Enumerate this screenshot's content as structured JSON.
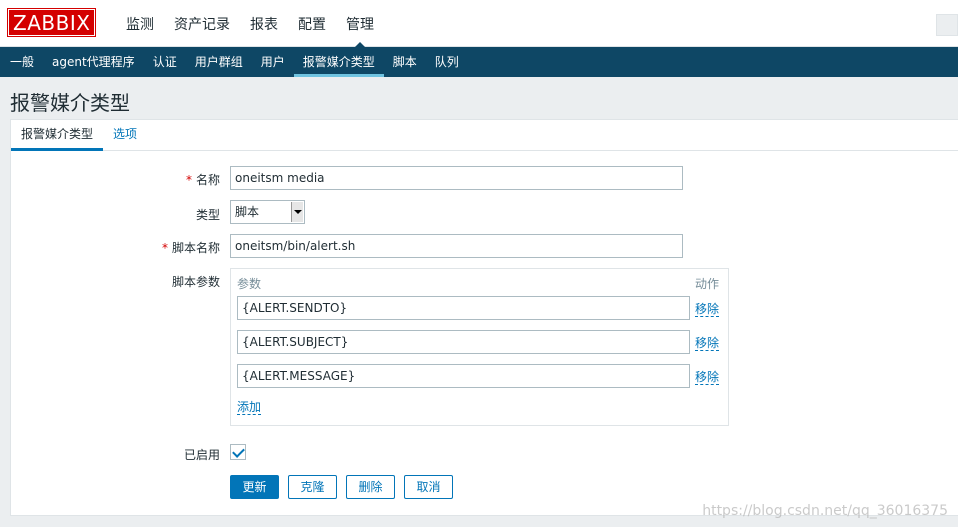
{
  "logo": "ZABBIX",
  "main_nav": [
    "监测",
    "资产记录",
    "报表",
    "配置",
    "管理"
  ],
  "sub_nav": [
    "一般",
    "agent代理程序",
    "认证",
    "用户群组",
    "用户",
    "报警媒介类型",
    "脚本",
    "队列"
  ],
  "page_title": "报警媒介类型",
  "tabs": [
    "报警媒介类型",
    "选项"
  ],
  "form": {
    "name_label": "名称",
    "name_value": "oneitsm media",
    "type_label": "类型",
    "type_value": "脚本",
    "script_name_label": "脚本名称",
    "script_name_value": "oneitsm/bin/alert.sh",
    "script_params_label": "脚本参数",
    "params_header_param": "参数",
    "params_header_action": "动作",
    "params": [
      "{ALERT.SENDTO}",
      "{ALERT.SUBJECT}",
      "{ALERT.MESSAGE}"
    ],
    "remove_label": "移除",
    "add_label": "添加",
    "enabled_label": "已启用",
    "enabled": true,
    "required_mark": "*"
  },
  "buttons": {
    "update": "更新",
    "clone": "克隆",
    "delete": "删除",
    "cancel": "取消"
  },
  "watermark": "https://blog.csdn.net/qq_36016375",
  "colors": {
    "header_bg": "#0e4765",
    "accent": "#0275b8",
    "logo_red": "#d40000"
  }
}
